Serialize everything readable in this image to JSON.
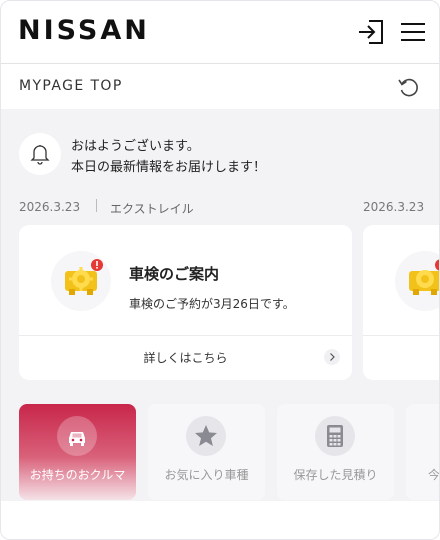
{
  "header": {
    "brand": "NISSAN",
    "login_icon": "login-icon",
    "menu_icon": "hamburger-menu-icon"
  },
  "subbar": {
    "title": "MYPAGE TOP",
    "refresh_icon": "refresh-icon"
  },
  "notice": {
    "icon": "bell-icon",
    "line1": "おはようございます。",
    "line2": "本日の最新情報をお届けします！"
  },
  "feed": {
    "date1": "2026.3.23",
    "car_name": "エクストレイル",
    "date2": "2026.3.23"
  },
  "cards": [
    {
      "icon": "car-inspection-gear-icon",
      "title": "車検のご案内",
      "text": "車検のご予約が3月26日です。",
      "link_label": "詳しくはこちら"
    },
    {
      "icon": "car-inspection-gear-icon",
      "title": "",
      "text": "",
      "link_label": ""
    }
  ],
  "tiles": [
    {
      "label": "お持ちのおクルマ",
      "icon": "car-icon",
      "active": true
    },
    {
      "label": "お気に入り車種",
      "icon": "star-icon",
      "active": false
    },
    {
      "label": "保存した見積り",
      "icon": "calculator-icon",
      "active": false
    },
    {
      "label": "今",
      "icon": "",
      "active": false
    }
  ],
  "colors": {
    "accent": "#c8264a",
    "badge": "#e53935",
    "icon_yellow": "#f2c21b"
  }
}
